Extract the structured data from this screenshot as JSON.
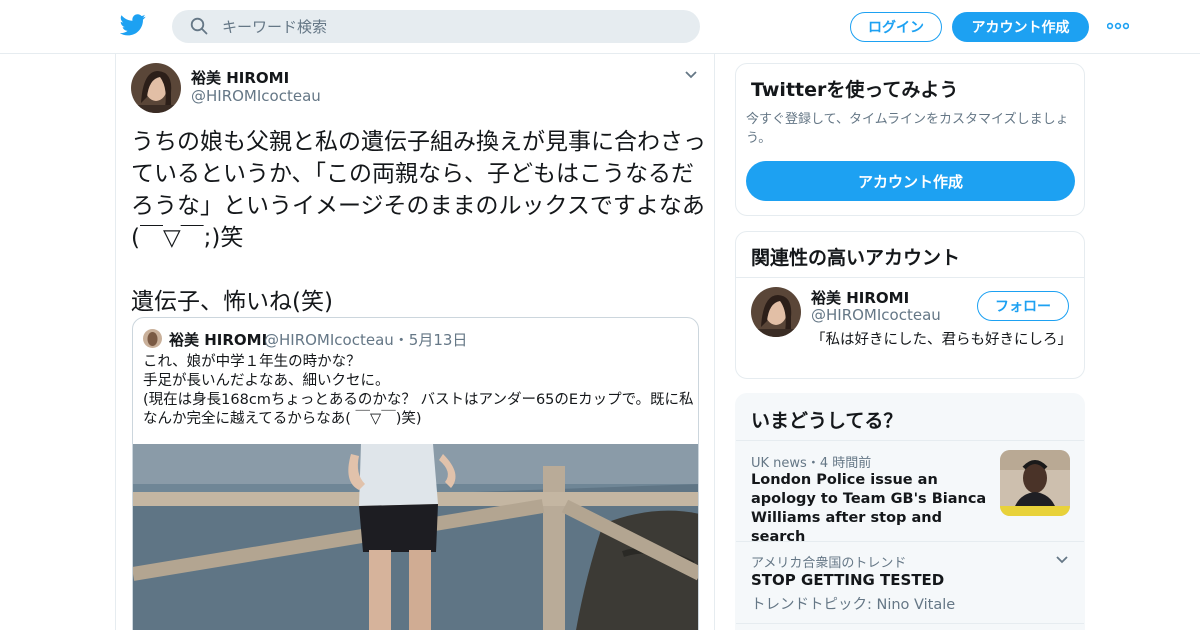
{
  "brand_color": "#1da1f2",
  "header": {
    "logo_icon": "twitter-bird-icon",
    "search_placeholder": "キーワード検索",
    "login_label": "ログイン",
    "signup_label": "アカウント作成",
    "more_icon": "more-dots-icon"
  },
  "tweet": {
    "author_name": "裕美 HIROMI",
    "author_handle": "@HIROMIcocteau",
    "text": "うちの娘も父親と私の遺伝子組み換えが見事に合わさっているというか、「この両親なら、子どもはこうなるだろうな」というイメージそのままのルックスですよなあ(￣▽￣;)笑\n\n遺伝子、怖いね(笑)",
    "quoted": {
      "author_name": "裕美 HIROMI",
      "author_handle_date": "@HIROMIcocteau・5月13日",
      "text": "これ、娘が中学１年生の時かな？\n手足が長いんだよなあ、細いクセに。\n(現在は身長168cmちょっとあるのかな？ バストはアンダー65のEカップで。既に私なんか完全に越えてるからなあ( ￣▽￣)笑)"
    }
  },
  "sidebar": {
    "try_card": {
      "title": "Twitterを使ってみよう",
      "description": "今すぐ登録して、タイムラインをカスタマイズしましょう。",
      "button_label": "アカウント作成"
    },
    "related_card": {
      "title": "関連性の高いアカウント",
      "account_name": "裕美 HIROMI",
      "account_handle": "@HIROMIcocteau",
      "follow_label": "フォロー",
      "bio": "「私は好きにした、君らも好きにしろ」"
    },
    "trends_card": {
      "title": "いまどうしてる？",
      "items": [
        {
          "meta": "UK news・4 時間前",
          "title": "London Police issue an apology to Team GB's Bianca Williams after stop and search"
        },
        {
          "meta": "アメリカ合衆国のトレンド",
          "title": "STOP GETTING TESTED",
          "subtitle": "トレンドトピック: Nino Vitale"
        }
      ]
    }
  }
}
